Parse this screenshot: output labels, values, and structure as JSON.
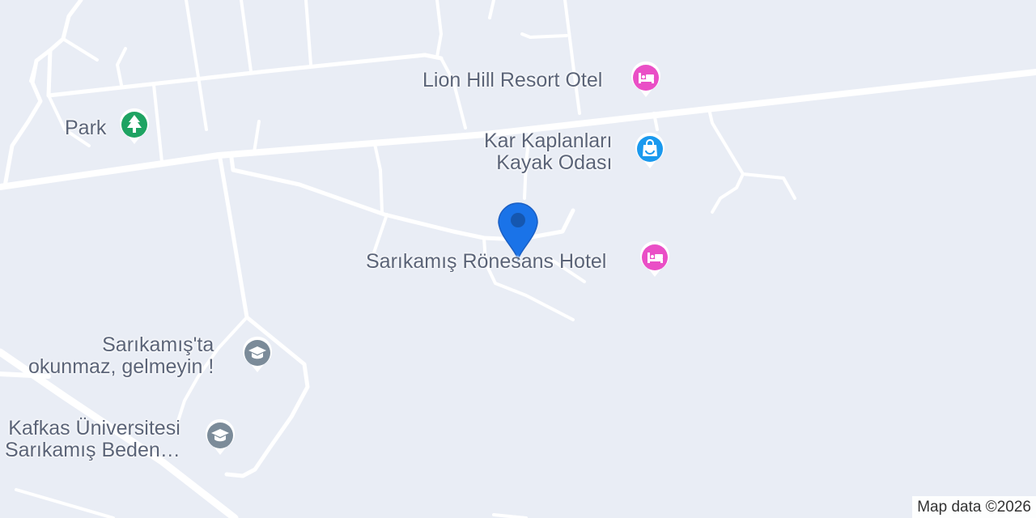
{
  "colors": {
    "background": "#e9edf5",
    "road": "#ffffff",
    "label": "#5b6478",
    "hotel_pin": "#ea4fc6",
    "park_pin": "#1ea362",
    "shop_pin": "#1a99ee",
    "school_pin": "#7b8b99",
    "location_pin": "#1a73e8"
  },
  "pois": {
    "lion_hill": {
      "name": "Lion Hill Resort Otel",
      "icon": "hotel-icon"
    },
    "park": {
      "name": "Park",
      "icon": "tree-icon"
    },
    "kar_kaplanlari": {
      "line1": "Kar Kaplanları",
      "line2": "Kayak Odası",
      "icon": "shopping-bag-icon"
    },
    "ronesans": {
      "name": "Sarıkamış Rönesans Hotel",
      "icon": "hotel-icon"
    },
    "okunmaz": {
      "line1": "Sarıkamış'ta",
      "line2": "okunmaz, gelmeyin !",
      "icon": "school-icon"
    },
    "kafkas": {
      "line1": "Kafkas Üniversitesi",
      "line2": "Sarıkamış Beden…",
      "icon": "school-icon"
    }
  },
  "dropped_pin": {
    "icon": "location-pin-icon"
  },
  "attribution": "Map data ©2026"
}
